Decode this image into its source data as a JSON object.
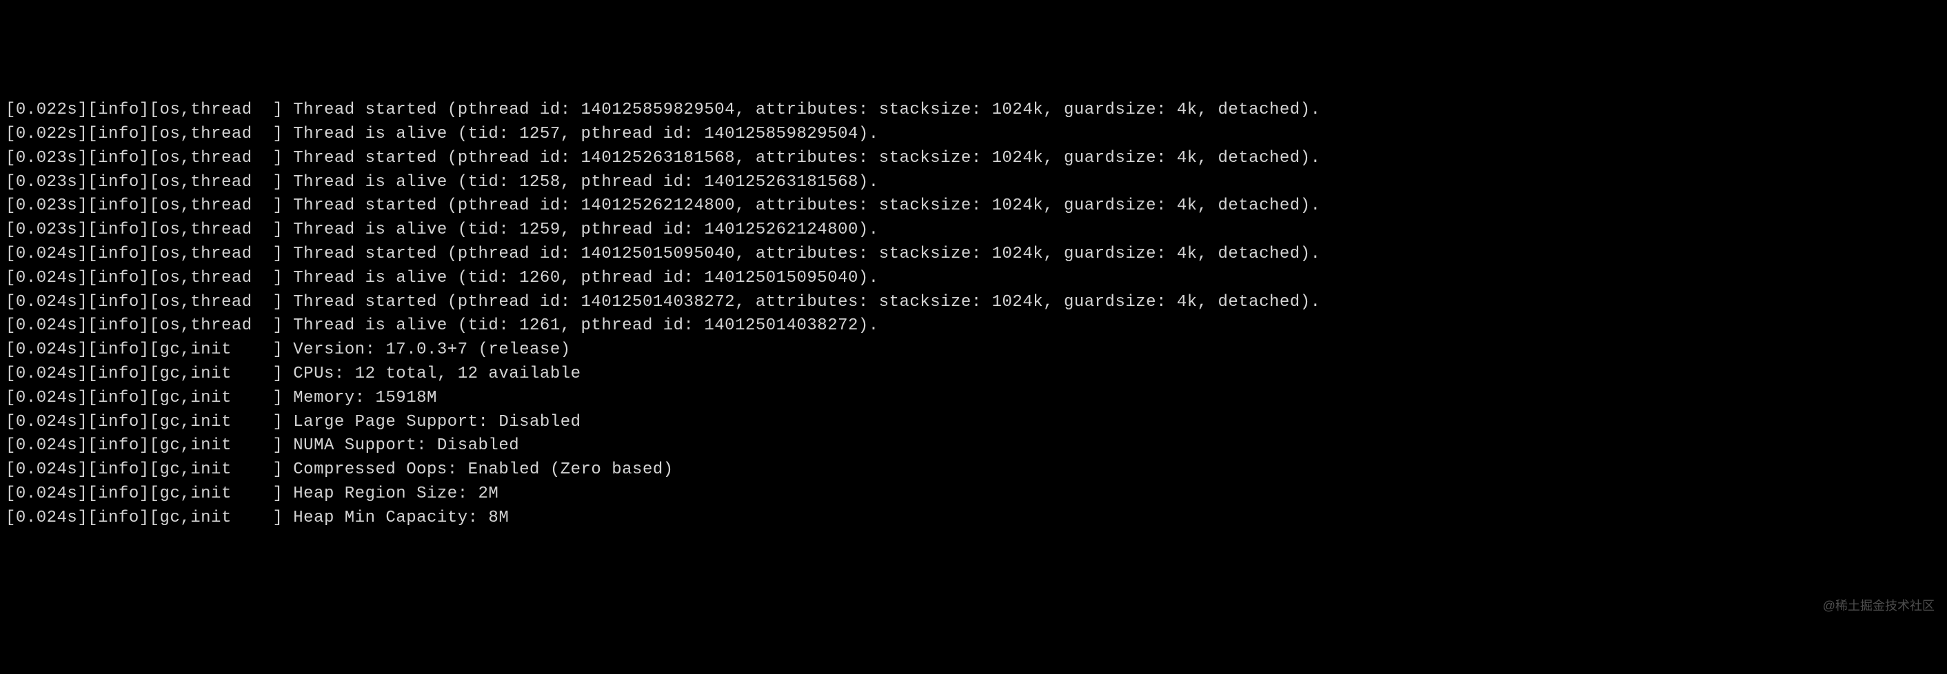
{
  "log_lines": [
    {
      "time": "0.022s",
      "level": "info",
      "tags": "os,thread  ",
      "msg": "Thread started (pthread id: 140125859829504, attributes: stacksize: 1024k, guardsize: 4k, detached)."
    },
    {
      "time": "0.022s",
      "level": "info",
      "tags": "os,thread  ",
      "msg": "Thread is alive (tid: 1257, pthread id: 140125859829504)."
    },
    {
      "time": "0.023s",
      "level": "info",
      "tags": "os,thread  ",
      "msg": "Thread started (pthread id: 140125263181568, attributes: stacksize: 1024k, guardsize: 4k, detached)."
    },
    {
      "time": "0.023s",
      "level": "info",
      "tags": "os,thread  ",
      "msg": "Thread is alive (tid: 1258, pthread id: 140125263181568)."
    },
    {
      "time": "0.023s",
      "level": "info",
      "tags": "os,thread  ",
      "msg": "Thread started (pthread id: 140125262124800, attributes: stacksize: 1024k, guardsize: 4k, detached)."
    },
    {
      "time": "0.023s",
      "level": "info",
      "tags": "os,thread  ",
      "msg": "Thread is alive (tid: 1259, pthread id: 140125262124800)."
    },
    {
      "time": "0.024s",
      "level": "info",
      "tags": "os,thread  ",
      "msg": "Thread started (pthread id: 140125015095040, attributes: stacksize: 1024k, guardsize: 4k, detached)."
    },
    {
      "time": "0.024s",
      "level": "info",
      "tags": "os,thread  ",
      "msg": "Thread is alive (tid: 1260, pthread id: 140125015095040)."
    },
    {
      "time": "0.024s",
      "level": "info",
      "tags": "os,thread  ",
      "msg": "Thread started (pthread id: 140125014038272, attributes: stacksize: 1024k, guardsize: 4k, detached)."
    },
    {
      "time": "0.024s",
      "level": "info",
      "tags": "os,thread  ",
      "msg": "Thread is alive (tid: 1261, pthread id: 140125014038272)."
    },
    {
      "time": "0.024s",
      "level": "info",
      "tags": "gc,init    ",
      "msg": "Version: 17.0.3+7 (release)"
    },
    {
      "time": "0.024s",
      "level": "info",
      "tags": "gc,init    ",
      "msg": "CPUs: 12 total, 12 available"
    },
    {
      "time": "0.024s",
      "level": "info",
      "tags": "gc,init    ",
      "msg": "Memory: 15918M"
    },
    {
      "time": "0.024s",
      "level": "info",
      "tags": "gc,init    ",
      "msg": "Large Page Support: Disabled"
    },
    {
      "time": "0.024s",
      "level": "info",
      "tags": "gc,init    ",
      "msg": "NUMA Support: Disabled"
    },
    {
      "time": "0.024s",
      "level": "info",
      "tags": "gc,init    ",
      "msg": "Compressed Oops: Enabled (Zero based)"
    },
    {
      "time": "0.024s",
      "level": "info",
      "tags": "gc,init    ",
      "msg": "Heap Region Size: 2M"
    },
    {
      "time": "0.024s",
      "level": "info",
      "tags": "gc,init    ",
      "msg": "Heap Min Capacity: 8M"
    }
  ],
  "watermark": "@稀土掘金技术社区"
}
